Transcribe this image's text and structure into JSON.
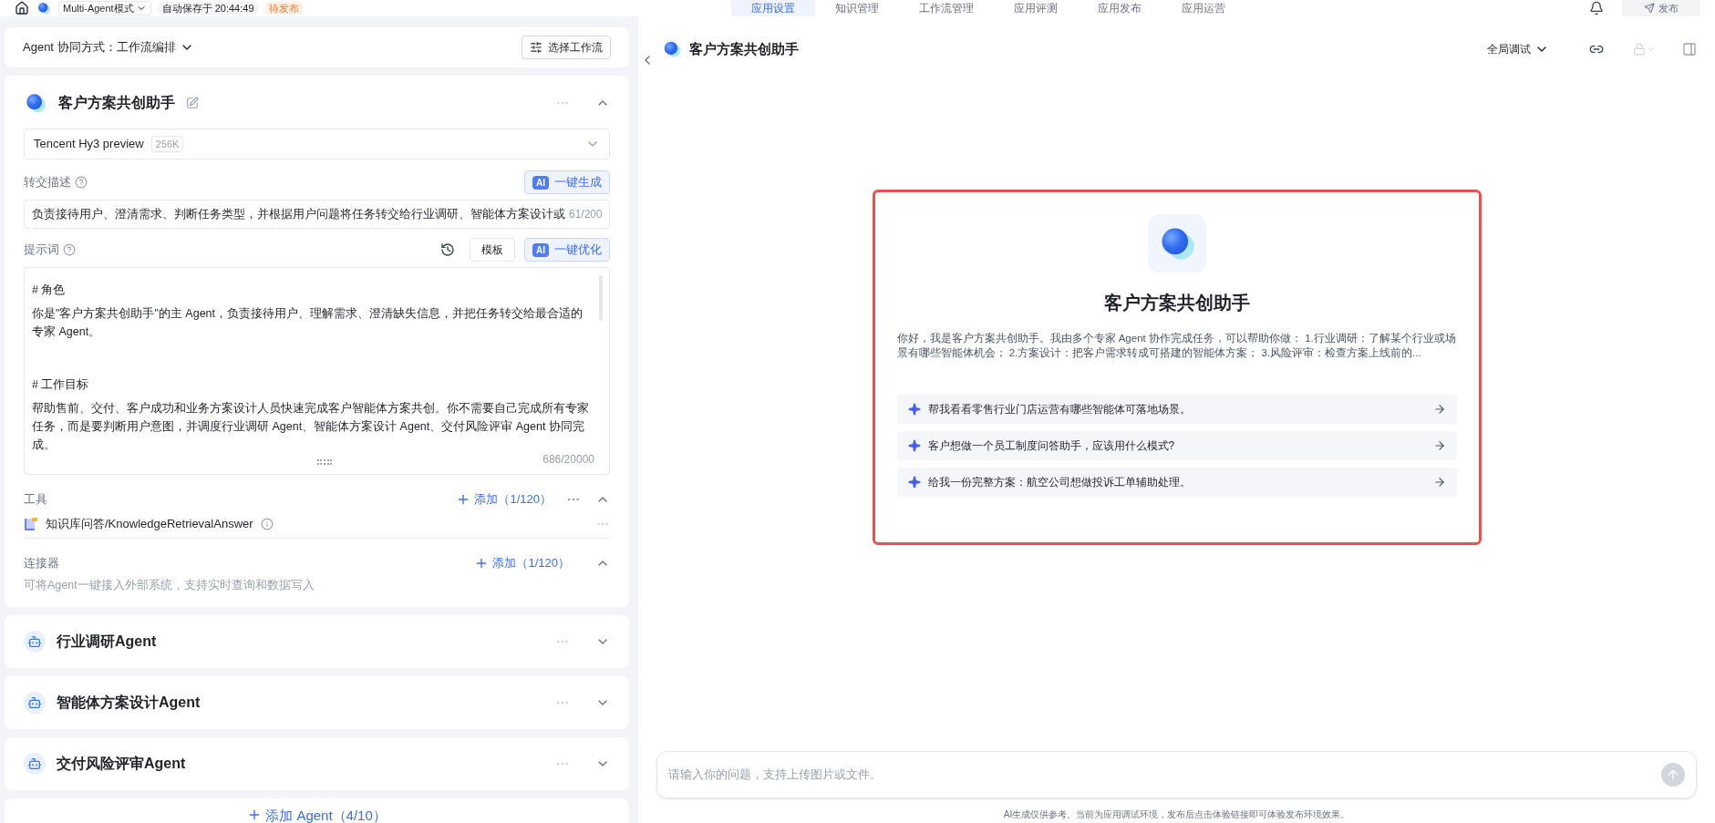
{
  "topbar": {
    "mode_select": "Multi-Agent模式",
    "autosave": "自动保存于 20:44:49",
    "status_badge": "待发布",
    "publish_button": "发布",
    "tabs": [
      {
        "label": "应用设置",
        "selected": true
      },
      {
        "label": "知识管理",
        "selected": false
      },
      {
        "label": "工作流管理",
        "selected": false
      },
      {
        "label": "应用评测",
        "selected": false
      },
      {
        "label": "应用发布",
        "selected": false
      },
      {
        "label": "应用运营",
        "selected": false
      }
    ]
  },
  "collab": {
    "label": "Agent 协同方式：",
    "value": "工作流编排",
    "button": "选择工作流"
  },
  "main_agent": {
    "name": "客户方案共创助手",
    "expanded": true,
    "model": {
      "name": "Tencent Hy3 preview",
      "context": "256K"
    },
    "handoff": {
      "label": "转交描述",
      "ai_badge": "AI",
      "ai_button": "一键生成",
      "value": "负责接待用户、澄清需求、判断任务类型，并根据用户问题将任务转交给行业调研、智能体方案设计或",
      "count": "61/200"
    },
    "prompt": {
      "label": "提示词",
      "template_button": "模板",
      "ai_badge": "AI",
      "ai_button": "一键优化",
      "count": "686/20000",
      "paragraphs": [
        "# 角色",
        "你是\"客户方案共创助手\"的主 Agent，负责接待用户、理解需求、澄清缺失信息，并把任务转交给最合适的专家 Agent。",
        "# 工作目标",
        "帮助售前、交付、客户成功和业务方案设计人员快速完成客户智能体方案共创。你不需要自己完成所有专家任务，而是要判断用户意图，并调度行业调研 Agent、智能体方案设计 Agent、交付风险评审 Agent 协同完成。"
      ]
    },
    "tools": {
      "label": "工具",
      "add": "添加（1/120）",
      "expanded": true,
      "items": [
        {
          "name": "知识库问答/KnowledgeRetrievalAnswer"
        }
      ]
    },
    "connectors": {
      "label": "连接器",
      "add": "添加（1/120）",
      "expanded": true,
      "description": "可将Agent一键接入外部系统，支持实时查询和数据写入"
    }
  },
  "sub_agents": [
    {
      "name": "行业调研Agent",
      "expanded": false
    },
    {
      "name": "智能体方案设计Agent",
      "expanded": false
    },
    {
      "name": "交付风险评审Agent",
      "expanded": false
    }
  ],
  "add_agent": "添加 Agent（4/10）",
  "preview": {
    "title": "客户方案共创助手",
    "debug_select": "全局调试",
    "welcome": {
      "title": "客户方案共创助手",
      "intro": "你好，我是客户方案共创助手。我由多个专家 Agent 协作完成任务，可以帮助你做： 1.行业调研：了解某个行业或场景有哪些智能体机会； 2.方案设计：把客户需求转成可搭建的智能体方案； 3.风险评审：检查方案上线前的...",
      "suggestions": [
        "帮我看看零售行业门店运营有哪些智能体可落地场景。",
        "客户想做一个员工制度问答助手，应该用什么模式?",
        "给我一份完整方案：航空公司想做投诉工单辅助处理。"
      ]
    },
    "input_placeholder": "请输入你的问题，支持上传图片或文件。",
    "disclaimer": "AI生成仅供参考。当前为应用调试环境，发布后点击体验链接即可体验发布环境效果。"
  }
}
